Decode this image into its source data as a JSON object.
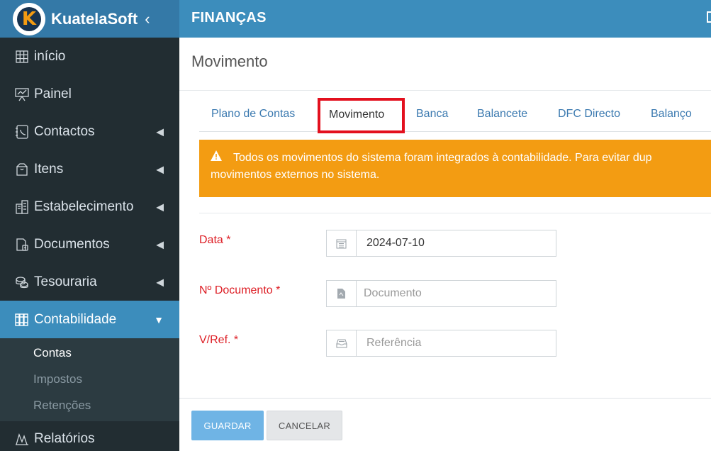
{
  "brand": {
    "name": "KuatelaSoft",
    "logo_letter": "K",
    "collapse_glyph": "‹"
  },
  "header": {
    "module_title": "FINANÇAS"
  },
  "page": {
    "title": "Movimento"
  },
  "sidebar": {
    "items": [
      {
        "label": "início",
        "icon": "grid-icon",
        "has_arrow": false
      },
      {
        "label": "Painel",
        "icon": "presentation-icon",
        "has_arrow": false
      },
      {
        "label": "Contactos",
        "icon": "contacts-icon",
        "has_arrow": true
      },
      {
        "label": "Itens",
        "icon": "box-icon",
        "has_arrow": true
      },
      {
        "label": "Estabelecimento",
        "icon": "building-icon",
        "has_arrow": true
      },
      {
        "label": "Documentos",
        "icon": "documents-icon",
        "has_arrow": true
      },
      {
        "label": "Tesouraria",
        "icon": "coins-icon",
        "has_arrow": true
      },
      {
        "label": "Contabilidade",
        "icon": "ledger-icon",
        "has_arrow": true,
        "active": true
      },
      {
        "label": "Relatórios",
        "icon": "chart-icon",
        "has_arrow": false
      }
    ],
    "submenu": [
      "Contas",
      "Impostos",
      "Retenções"
    ]
  },
  "tabs": [
    "Plano de Contas",
    "Movimento",
    "Banca",
    "Balancete",
    "DFC Directo",
    "Balanço"
  ],
  "alert": {
    "line1": "Todos os movimentos do sistema foram integrados à contabilidade. Para evitar dup",
    "line2": "movimentos externos no sistema."
  },
  "form": {
    "date_label": "Data *",
    "date_value": "2024-07-10",
    "doc_label": "Nº Documento *",
    "doc_placeholder": "Documento",
    "ref_label": "V/Ref. *",
    "ref_placeholder": "Referência"
  },
  "buttons": {
    "save": "GUARDAR",
    "cancel": "CANCELAR"
  },
  "colors": {
    "sidebar": "#222d32",
    "header": "#3c8dbc",
    "alert": "#f39c12",
    "required": "#dd1d24",
    "highlight": "#e3101e"
  }
}
